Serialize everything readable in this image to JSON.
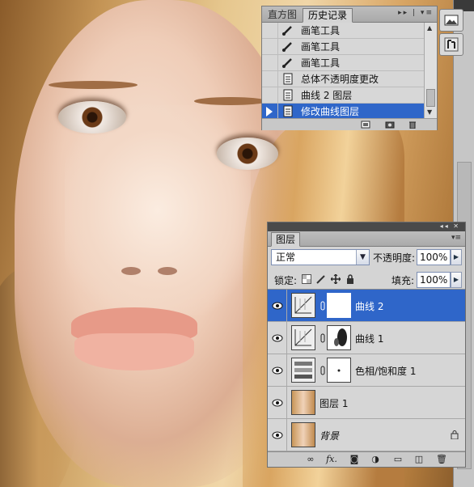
{
  "history": {
    "tabs": [
      "直方图",
      "历史记录"
    ],
    "active_tab": 1,
    "menu_glyph": "▸▸ | ▾≡",
    "items": [
      {
        "label": "画笔工具",
        "icon": "brush-icon",
        "selected": false
      },
      {
        "label": "画笔工具",
        "icon": "brush-icon",
        "selected": false
      },
      {
        "label": "画笔工具",
        "icon": "brush-icon",
        "selected": false
      },
      {
        "label": "总体不透明度更改",
        "icon": "document-icon",
        "selected": false
      },
      {
        "label": "曲线 2 图层",
        "icon": "document-icon",
        "selected": false
      },
      {
        "label": "修改曲线图层",
        "icon": "document-icon",
        "selected": true
      }
    ]
  },
  "layers": {
    "tab": "图层",
    "collapse_glyph": "◂◂ ✕",
    "menu_glyph": "▾≡",
    "blend_mode": "正常",
    "opacity_label": "不透明度:",
    "opacity_value": "100%",
    "lock_label": "锁定:",
    "fill_label": "填充:",
    "fill_value": "100%",
    "items": [
      {
        "name": "曲线 2",
        "type": "curves",
        "selected": true,
        "italic": false
      },
      {
        "name": "曲线 1",
        "type": "curves",
        "selected": false,
        "italic": false
      },
      {
        "name": "色相/饱和度 1",
        "type": "hue-saturation",
        "selected": false,
        "italic": false
      },
      {
        "name": "图层 1",
        "type": "photo",
        "selected": false,
        "italic": false
      },
      {
        "name": "背景",
        "type": "photo",
        "selected": false,
        "italic": true,
        "locked": true
      }
    ],
    "footer_icons": [
      "link-layers-icon",
      "fx-icon",
      "layer-mask-icon",
      "adjustment-layer-icon",
      "group-folder-icon",
      "new-layer-icon",
      "trash-icon"
    ]
  },
  "colors": {
    "selection": "#2f66c9",
    "panel_bg": "#d4d4d4",
    "tab_bar": "#aaaaaa"
  }
}
